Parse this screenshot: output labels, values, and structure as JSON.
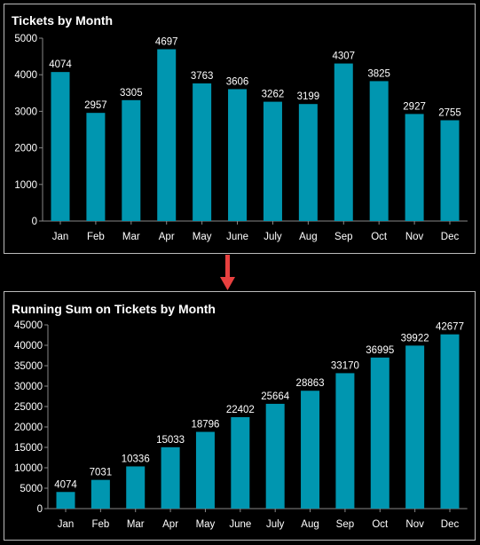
{
  "colors": {
    "bar": "#0096b0",
    "background": "#000000",
    "text": "#ffffff",
    "arrow": "#e8403f",
    "border": "#bbbbbb",
    "axis": "#888888"
  },
  "arrow_icon": "arrow-down-icon",
  "chart_data": [
    {
      "type": "bar",
      "title": "Tickets by Month",
      "categories": [
        "Jan",
        "Feb",
        "Mar",
        "Apr",
        "May",
        "June",
        "July",
        "Aug",
        "Sep",
        "Oct",
        "Nov",
        "Dec"
      ],
      "values": [
        4074,
        2957,
        3305,
        4697,
        3763,
        3606,
        3262,
        3199,
        4307,
        3825,
        2927,
        2755
      ],
      "ylim": [
        0,
        5000
      ],
      "yticks": [
        0,
        1000,
        2000,
        3000,
        4000,
        5000
      ],
      "xlabel": "",
      "ylabel": "",
      "grid": false,
      "data_labels": true
    },
    {
      "type": "bar",
      "title": "Running Sum on Tickets by Month",
      "categories": [
        "Jan",
        "Feb",
        "Mar",
        "Apr",
        "May",
        "June",
        "July",
        "Aug",
        "Sep",
        "Oct",
        "Nov",
        "Dec"
      ],
      "values": [
        4074,
        7031,
        10336,
        15033,
        18796,
        22402,
        25664,
        28863,
        33170,
        36995,
        39922,
        42677
      ],
      "ylim": [
        0,
        45000
      ],
      "yticks": [
        0,
        5000,
        10000,
        15000,
        20000,
        25000,
        30000,
        35000,
        40000,
        45000
      ],
      "xlabel": "",
      "ylabel": "",
      "grid": false,
      "data_labels": true
    }
  ]
}
